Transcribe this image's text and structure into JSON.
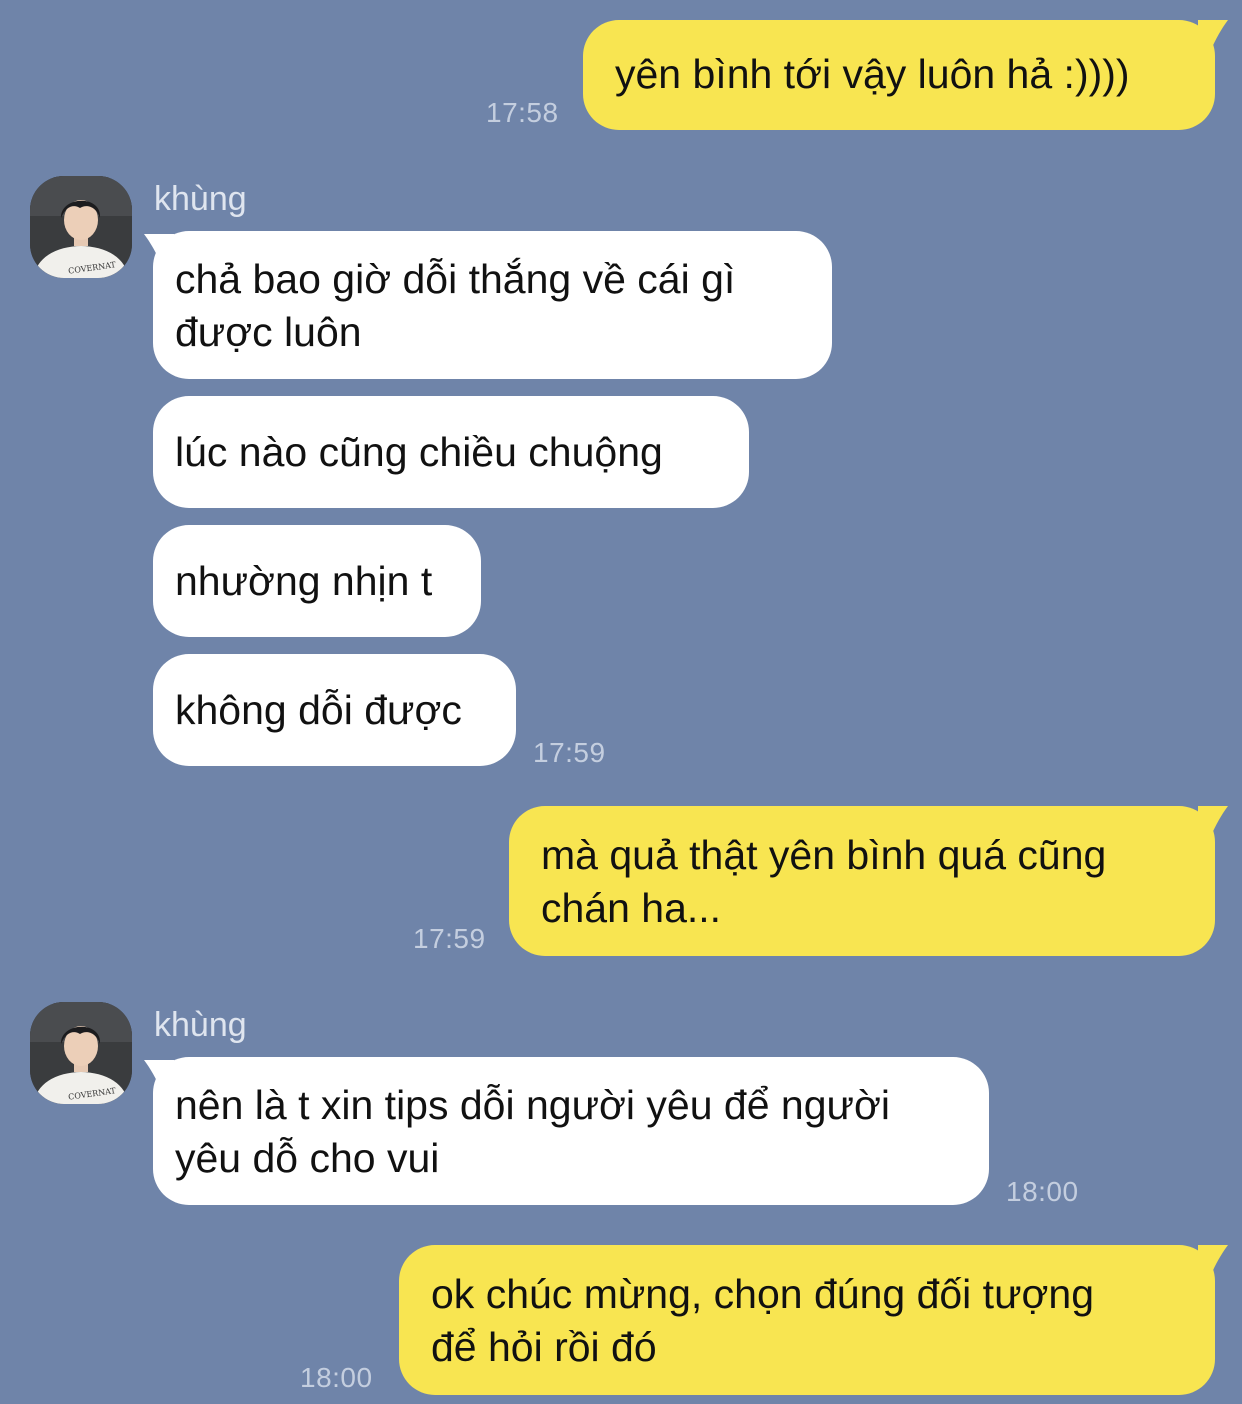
{
  "contact": {
    "name": "khùng"
  },
  "messages": [
    {
      "side": "out",
      "lines": [
        "yên bình tới vậy luôn hả :))))"
      ],
      "time": "17:58"
    },
    {
      "side": "in",
      "lines": [
        "chả bao giờ dỗi thắng về cái gì",
        "được luôn"
      ]
    },
    {
      "side": "in",
      "lines": [
        "lúc nào cũng chiều chuộng"
      ]
    },
    {
      "side": "in",
      "lines": [
        "nhường nhịn t"
      ]
    },
    {
      "side": "in",
      "lines": [
        "không dỗi được"
      ],
      "time": "17:59"
    },
    {
      "side": "out",
      "lines": [
        "mà quả thật yên bình quá cũng",
        "chán ha..."
      ],
      "time": "17:59"
    },
    {
      "side": "in",
      "lines": [
        "nên là t xin tips dỗi người yêu để người",
        "yêu dỗ cho vui"
      ],
      "time": "18:00"
    },
    {
      "side": "out",
      "lines": [
        "ok chúc mừng, chọn đúng đối tượng",
        "để hỏi rồi đó"
      ],
      "time": "18:00"
    }
  ],
  "avatar_shirt_text": "COVERNAT",
  "colors": {
    "background": "#6f84a9",
    "incoming_bubble": "#ffffff",
    "outgoing_bubble": "#f8e551",
    "timestamp": "#c4cedf",
    "sender_name": "#dfe5ef"
  }
}
